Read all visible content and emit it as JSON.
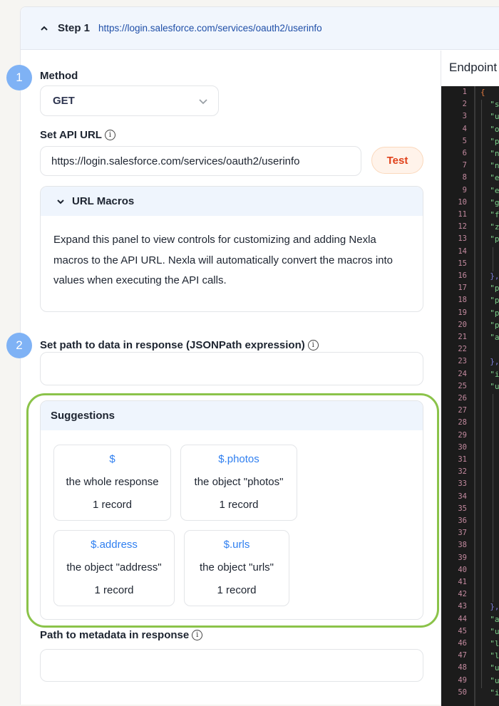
{
  "step": {
    "title": "Step 1",
    "url": "https://login.salesforce.com/services/oauth2/userinfo"
  },
  "method": {
    "badge": "1",
    "label": "Method",
    "value": "GET"
  },
  "api_url": {
    "label": "Set API URL",
    "info": "i",
    "value": "https://login.salesforce.com/services/oauth2/userinfo",
    "test_label": "Test"
  },
  "macros": {
    "title": "URL Macros",
    "description": "Expand this panel to view controls for customizing and adding Nexla macros to the API URL. Nexla will automatically convert the macros into values when executing the API calls."
  },
  "data_path": {
    "badge": "2",
    "label": "Set path to data in response (JSONPath expression)",
    "info": "i",
    "value": ""
  },
  "suggestions": {
    "title": "Suggestions",
    "items": [
      {
        "path": "$",
        "description": "the whole response",
        "records": "1 record"
      },
      {
        "path": "$.photos",
        "description": "the object \"photos\"",
        "records": "1 record"
      },
      {
        "path": "$.address",
        "description": "the object \"address\"",
        "records": "1 record"
      },
      {
        "path": "$.urls",
        "description": "the object \"urls\"",
        "records": "1 record"
      }
    ]
  },
  "metadata_path": {
    "label": "Path to metadata in response",
    "info": "i",
    "value": ""
  },
  "endpoint": {
    "title": "Endpoint",
    "lines": [
      {
        "n": "1",
        "t": "{",
        "k": "brace"
      },
      {
        "n": "2",
        "t": "  \"s",
        "k": "key"
      },
      {
        "n": "3",
        "t": "  \"u",
        "k": "key"
      },
      {
        "n": "4",
        "t": "  \"o",
        "k": "key"
      },
      {
        "n": "5",
        "t": "  \"p",
        "k": "key"
      },
      {
        "n": "6",
        "t": "  \"n",
        "k": "key"
      },
      {
        "n": "7",
        "t": "  \"n",
        "k": "key"
      },
      {
        "n": "8",
        "t": "  \"e",
        "k": "key"
      },
      {
        "n": "9",
        "t": "  \"e",
        "k": "key"
      },
      {
        "n": "10",
        "t": "  \"g",
        "k": "key"
      },
      {
        "n": "11",
        "t": "  \"f",
        "k": "key"
      },
      {
        "n": "12",
        "t": "  \"z",
        "k": "key"
      },
      {
        "n": "13",
        "t": "  \"p",
        "k": "key"
      },
      {
        "n": "14",
        "t": "    \"",
        "k": "key"
      },
      {
        "n": "15",
        "t": "    \"",
        "k": "key"
      },
      {
        "n": "16",
        "t": "  },",
        "k": "close"
      },
      {
        "n": "17",
        "t": "  \"p",
        "k": "key"
      },
      {
        "n": "18",
        "t": "  \"p",
        "k": "key"
      },
      {
        "n": "19",
        "t": "  \"p",
        "k": "key"
      },
      {
        "n": "20",
        "t": "  \"p",
        "k": "key"
      },
      {
        "n": "21",
        "t": "  \"a",
        "k": "key"
      },
      {
        "n": "22",
        "t": "",
        "k": "key"
      },
      {
        "n": "23",
        "t": "  },",
        "k": "close"
      },
      {
        "n": "24",
        "t": "  \"i",
        "k": "key"
      },
      {
        "n": "25",
        "t": "  \"u",
        "k": "key"
      },
      {
        "n": "26",
        "t": "    \"",
        "k": "key"
      },
      {
        "n": "27",
        "t": "    \"",
        "k": "key"
      },
      {
        "n": "28",
        "t": "    \"",
        "k": "key"
      },
      {
        "n": "29",
        "t": "    \"",
        "k": "key"
      },
      {
        "n": "30",
        "t": "    \"",
        "k": "key"
      },
      {
        "n": "31",
        "t": "    \"",
        "k": "key"
      },
      {
        "n": "32",
        "t": "    \"",
        "k": "key"
      },
      {
        "n": "33",
        "t": "    \"",
        "k": "key"
      },
      {
        "n": "34",
        "t": "    \"",
        "k": "key"
      },
      {
        "n": "35",
        "t": "    \"",
        "k": "key"
      },
      {
        "n": "36",
        "t": "    \"",
        "k": "key"
      },
      {
        "n": "37",
        "t": "    \"",
        "k": "key"
      },
      {
        "n": "38",
        "t": "    \"",
        "k": "key"
      },
      {
        "n": "39",
        "t": "    \"",
        "k": "key"
      },
      {
        "n": "40",
        "t": "    \"",
        "k": "key"
      },
      {
        "n": "41",
        "t": "    \"",
        "k": "key"
      },
      {
        "n": "42",
        "t": "    \"",
        "k": "key"
      },
      {
        "n": "43",
        "t": "  },",
        "k": "close"
      },
      {
        "n": "44",
        "t": "  \"a",
        "k": "key"
      },
      {
        "n": "45",
        "t": "  \"u",
        "k": "key"
      },
      {
        "n": "46",
        "t": "  \"l",
        "k": "key"
      },
      {
        "n": "47",
        "t": "  \"l",
        "k": "key"
      },
      {
        "n": "48",
        "t": "  \"u",
        "k": "key"
      },
      {
        "n": "49",
        "t": "  \"u",
        "k": "key"
      },
      {
        "n": "50",
        "t": "  \"i",
        "k": "key"
      }
    ]
  }
}
